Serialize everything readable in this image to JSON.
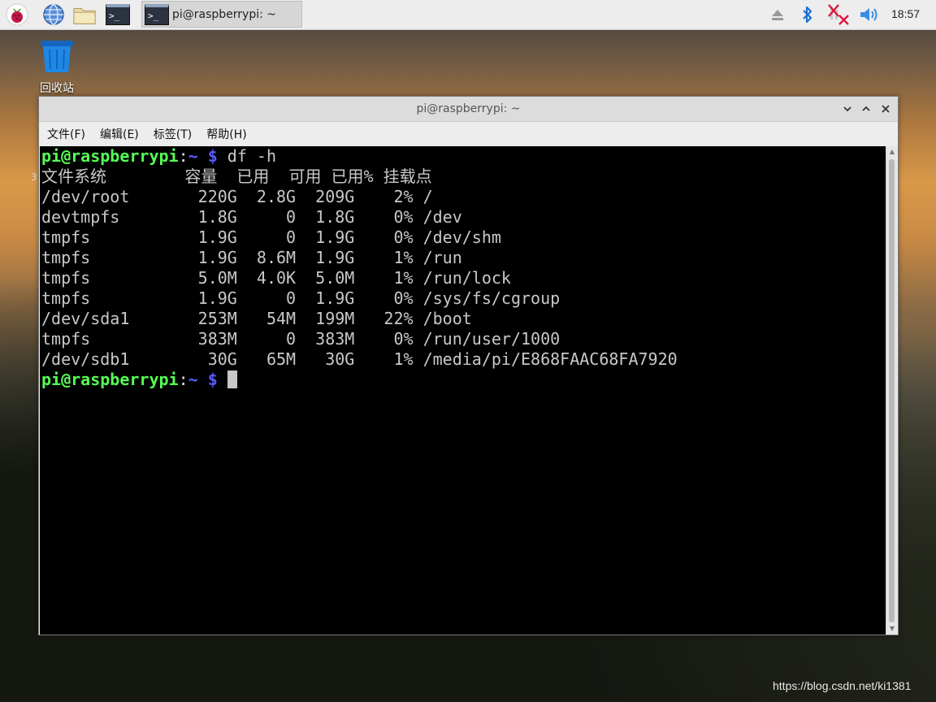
{
  "taskbar": {
    "task_title": "pi@raspberrypi: ~",
    "clock": "18:57",
    "icons": [
      "raspberry-menu-icon",
      "web-browser-icon",
      "file-manager-icon",
      "terminal-icon"
    ],
    "tray": [
      "eject-icon",
      "bluetooth-icon",
      "network-disconnected-icon",
      "volume-icon"
    ]
  },
  "desktop": {
    "trash_label": "回收站",
    "stray_char": "3"
  },
  "window": {
    "title": "pi@raspberrypi: ~",
    "menu": [
      "文件(F)",
      "编辑(E)",
      "标签(T)",
      "帮助(H)"
    ]
  },
  "terminal": {
    "prompt_user": "pi@raspberrypi",
    "prompt_sep": ":",
    "prompt_path": "~ $",
    "command": " df -h",
    "lines": [
      "文件系统        容量  已用  可用 已用% 挂载点",
      "/dev/root       220G  2.8G  209G    2% /",
      "devtmpfs        1.8G     0  1.8G    0% /dev",
      "tmpfs           1.9G     0  1.9G    0% /dev/shm",
      "tmpfs           1.9G  8.6M  1.9G    1% /run",
      "tmpfs           5.0M  4.0K  5.0M    1% /run/lock",
      "tmpfs           1.9G     0  1.9G    0% /sys/fs/cgroup",
      "/dev/sda1       253M   54M  199M   22% /boot",
      "tmpfs           383M     0  383M    0% /run/user/1000",
      "/dev/sdb1        30G   65M   30G    1% /media/pi/E868FAAC68FA7920"
    ]
  },
  "watermark": "https://blog.csdn.net/ki1381"
}
